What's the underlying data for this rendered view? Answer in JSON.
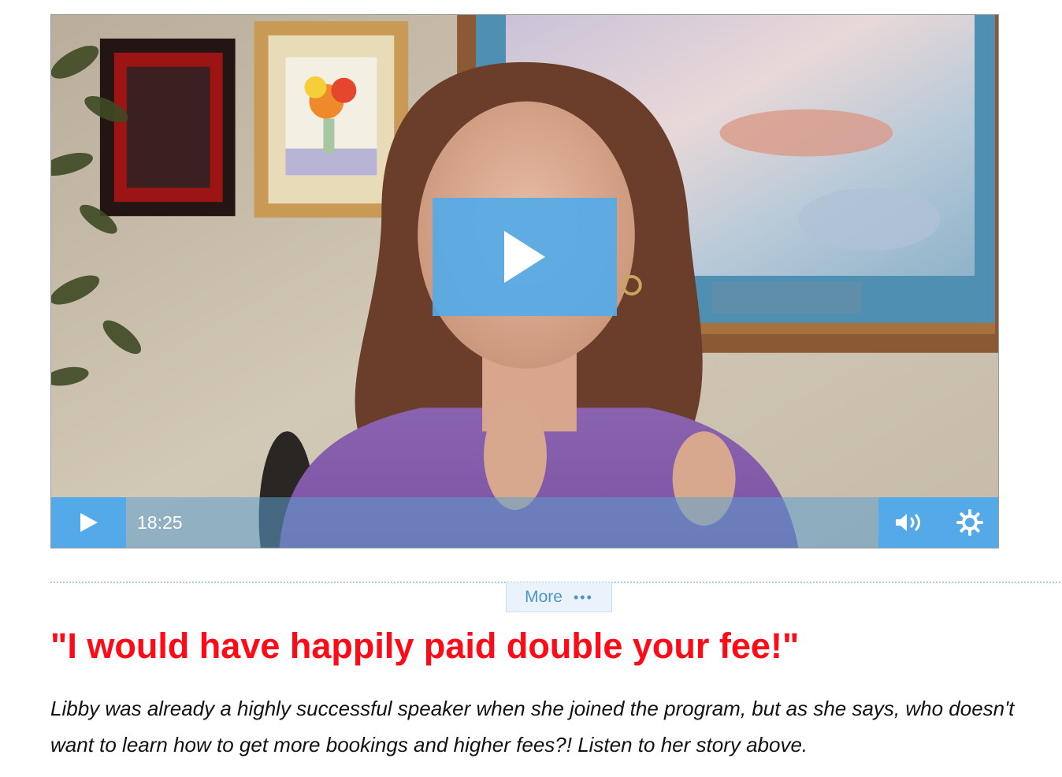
{
  "video": {
    "time_display": "18:25",
    "accent_color": "#54aae8",
    "icons": {
      "big_play": "play-icon",
      "control_play": "play-icon",
      "volume": "volume-icon",
      "settings": "gear-icon"
    }
  },
  "more": {
    "label": "More",
    "dots": "•••"
  },
  "testimonial": {
    "headline": "\"I would have happily paid double your fee!\"",
    "headline_color": "#ff0a17",
    "description": "Libby was already a highly successful speaker when she joined the program, but as she says, who doesn't want to learn how to get more bookings and higher fees?! Listen to her story above."
  }
}
